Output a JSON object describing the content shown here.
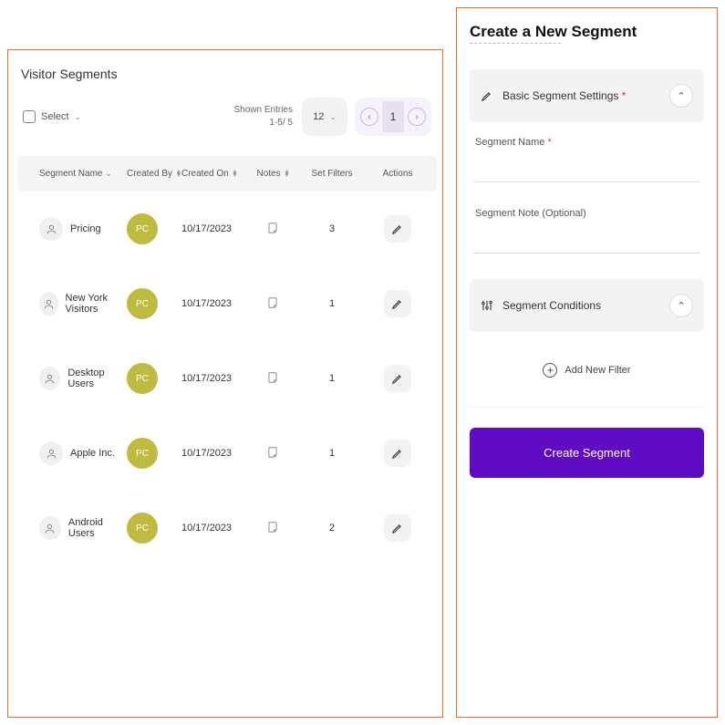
{
  "left": {
    "title": "Visitor Segments",
    "select_label": "Select",
    "shown_entries_label": "Shown Entries",
    "shown_entries_range": "1-5/ 5",
    "entries_per_page": "12",
    "current_page": "1",
    "columns": {
      "name": "Segment Name",
      "created_by": "Created By",
      "created_on": "Created On",
      "notes": "Notes",
      "filters": "Set Filters",
      "actions": "Actions"
    },
    "rows": [
      {
        "name": "Pricing",
        "by": "PC",
        "on": "10/17/2023",
        "filters": "3"
      },
      {
        "name": "New York Visitors",
        "by": "PC",
        "on": "10/17/2023",
        "filters": "1"
      },
      {
        "name": "Desktop Users",
        "by": "PC",
        "on": "10/17/2023",
        "filters": "1"
      },
      {
        "name": "Apple Inc.",
        "by": "PC",
        "on": "10/17/2023",
        "filters": "1"
      },
      {
        "name": "Android Users",
        "by": "PC",
        "on": "10/17/2023",
        "filters": "2"
      }
    ]
  },
  "right": {
    "title": "Create a New Segment",
    "basic_section": "Basic Segment Settings",
    "segment_name_label": "Segment Name",
    "segment_note_label": "Segment Note (Optional)",
    "conditions_section": "Segment Conditions",
    "add_filter_label": "Add New Filter",
    "create_button": "Create Segment"
  }
}
